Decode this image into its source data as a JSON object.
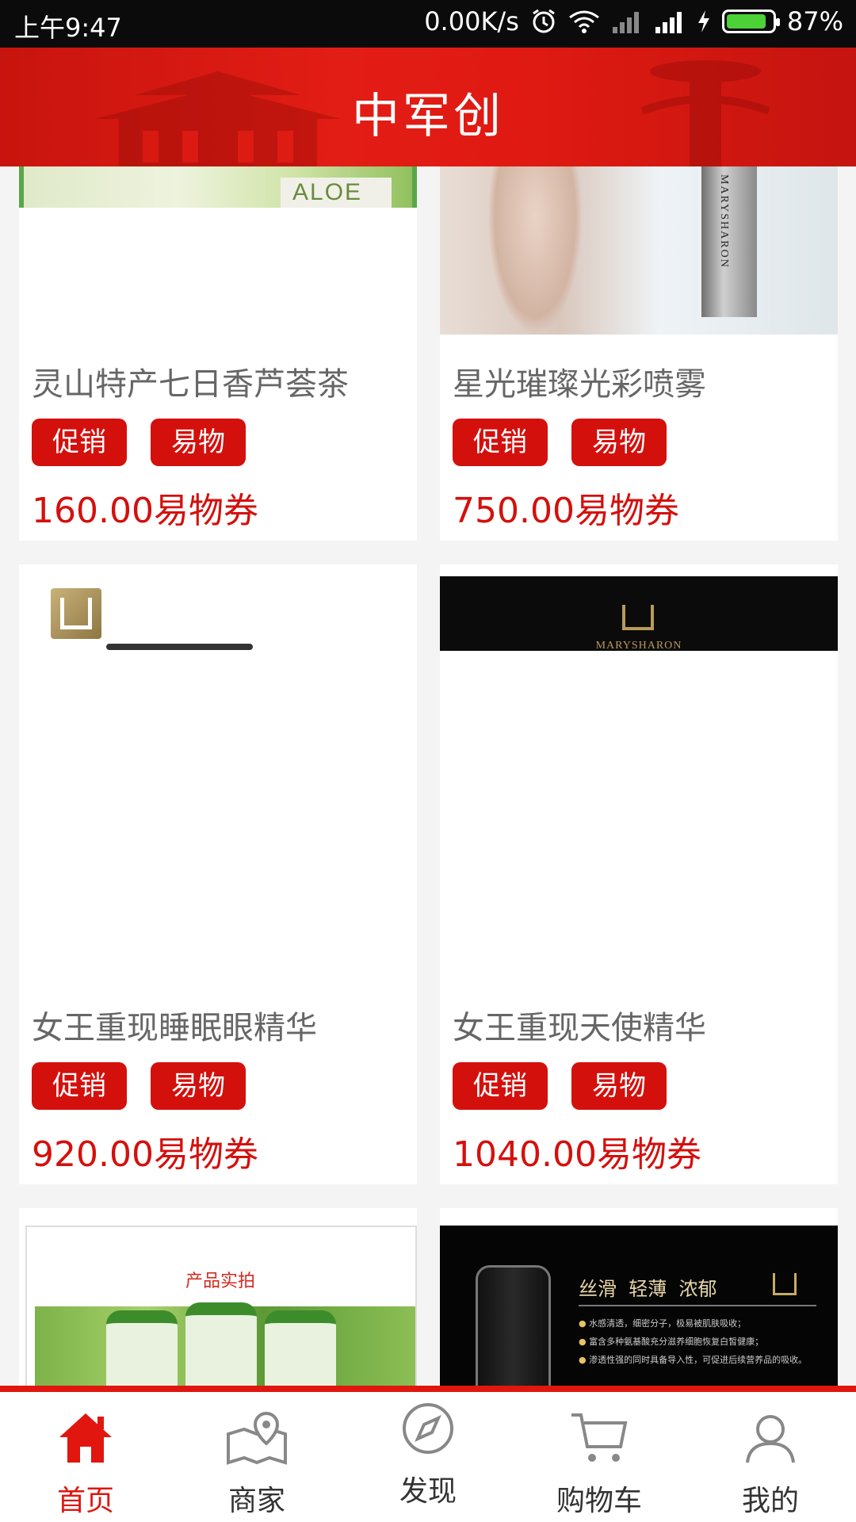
{
  "status_bar": {
    "time": "上午9:47",
    "net_speed": "0.00K/s",
    "battery_pct": "87%",
    "battery_level": 0.87
  },
  "header": {
    "title": "中军创"
  },
  "products": [
    {
      "name": "灵山特产七日香芦荟茶",
      "tags": [
        "促销",
        "易物"
      ],
      "price": "160.00易物券",
      "image_text": "ALOE"
    },
    {
      "name": "星光璀璨光彩喷雾",
      "tags": [
        "促销",
        "易物"
      ],
      "price": "750.00易物券",
      "image_text": "MARYSHARON"
    },
    {
      "name": "女王重现睡眠眼精华",
      "tags": [
        "促销",
        "易物"
      ],
      "price": "920.00易物券"
    },
    {
      "name": "女王重现天使精华",
      "tags": [
        "促销",
        "易物"
      ],
      "price": "1040.00易物券",
      "image_text": "MARYSHARON"
    },
    {
      "image_text": "产品实拍"
    },
    {
      "image_title": "丝滑  轻薄  浓郁",
      "image_bullets": [
        "水感清透，细密分子，极易被肌肤吸收；",
        "富含多种氨基酸充分滋养细胞恢复白皙健康；",
        "渗透性强的同时具备导入性，可促进后续营养品的吸收。"
      ]
    }
  ],
  "nav": {
    "items": [
      {
        "label": "首页",
        "icon": "home-icon",
        "active": true
      },
      {
        "label": "商家",
        "icon": "map-icon",
        "active": false
      },
      {
        "label": "发现",
        "icon": "compass-icon",
        "active": false
      },
      {
        "label": "购物车",
        "icon": "cart-icon",
        "active": false
      },
      {
        "label": "我的",
        "icon": "user-icon",
        "active": false
      }
    ]
  },
  "colors": {
    "brand_red": "#e0160f",
    "tag_red": "#d4100d",
    "price_red": "#d4100d"
  }
}
